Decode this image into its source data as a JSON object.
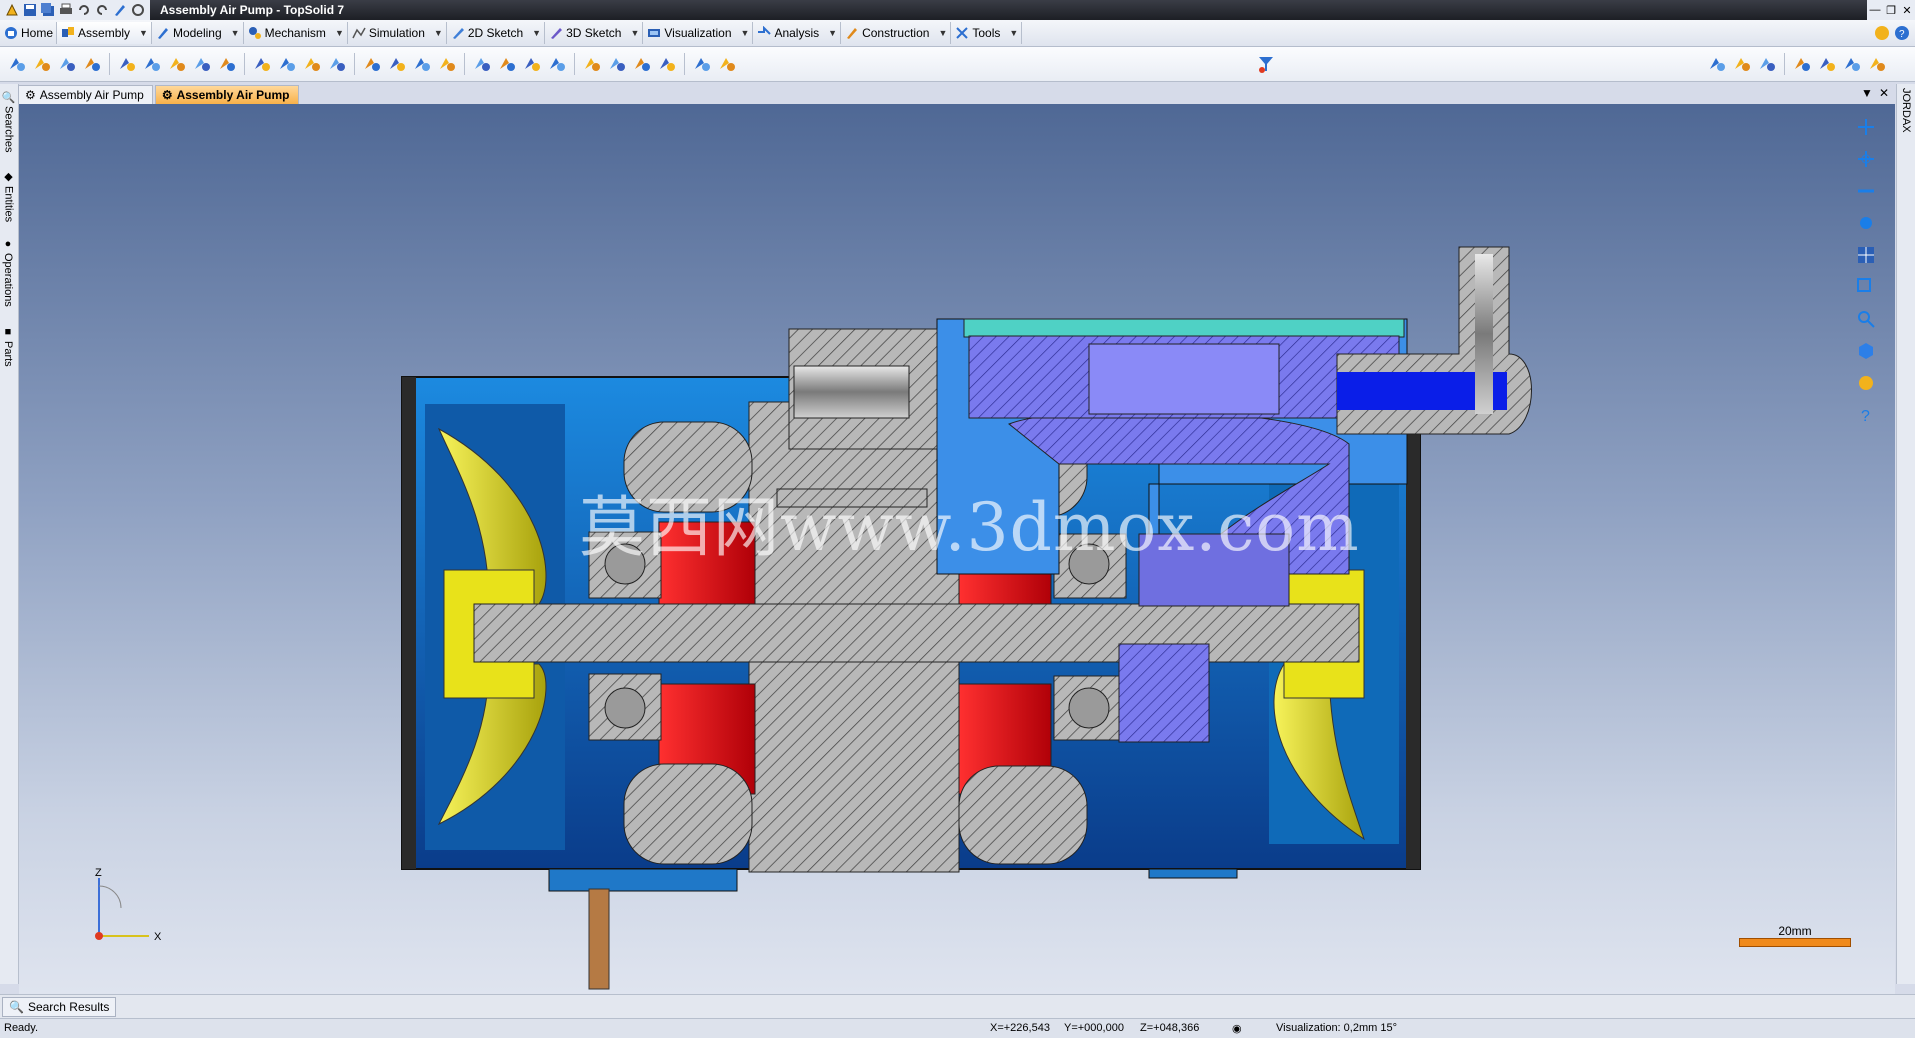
{
  "window": {
    "title": "Assembly Air Pump - TopSolid 7"
  },
  "menu": [
    {
      "label": "Home",
      "icon": "home-icon"
    },
    {
      "label": "Assembly",
      "icon": "assembly-icon"
    },
    {
      "label": "Modeling",
      "icon": "modeling-icon"
    },
    {
      "label": "Mechanism",
      "icon": "mechanism-icon"
    },
    {
      "label": "Simulation",
      "icon": "simulation-icon"
    },
    {
      "label": "2D Sketch",
      "icon": "sketch-2d-icon"
    },
    {
      "label": "3D Sketch",
      "icon": "sketch-3d-icon"
    },
    {
      "label": "Visualization",
      "icon": "visualization-icon"
    },
    {
      "label": "Analysis",
      "icon": "analysis-icon"
    },
    {
      "label": "Construction",
      "icon": "construction-icon"
    },
    {
      "label": "Tools",
      "icon": "tools-icon"
    }
  ],
  "doc_tabs": [
    {
      "label": "Assembly Air Pump",
      "active": false
    },
    {
      "label": "Assembly Air Pump",
      "active": true
    }
  ],
  "side_tabs": [
    "Searches",
    "Entities",
    "Operations",
    "Parts"
  ],
  "right_tab": "JORDAX",
  "viewport": {
    "watermark": "莫西网www.3dmox.com",
    "scale_label": "20mm",
    "axis_z": "Z",
    "axis_x": "X"
  },
  "bottom": {
    "search_results": "Search Results"
  },
  "status": {
    "ready": "Ready.",
    "x": "X=+226,543",
    "y": "Y=+000,000",
    "z": "Z=+048,366",
    "visualization": "Visualization: 0,2mm 15°"
  },
  "colors": {
    "accent_tab": "#f8b14a",
    "scale_bar": "#f08a1c",
    "cad_blue": "#1f78c8",
    "cad_purple": "#6f6fe0",
    "cad_red": "#e0101a",
    "cad_yellow": "#e8e21a"
  }
}
